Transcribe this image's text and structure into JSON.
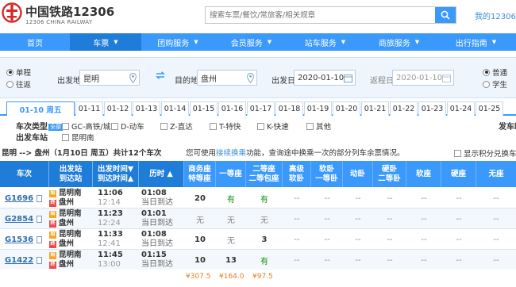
{
  "header": {
    "brand_cn": "中国铁路12306",
    "brand_en": "12306 CHINA RAILWAY",
    "search_placeholder": "搜索车票/餐饮/常旅客/相关规章",
    "my_account": "我的12306"
  },
  "nav": {
    "items": [
      {
        "label": "首页",
        "caret": false
      },
      {
        "label": "车票",
        "caret": true
      },
      {
        "label": "团购服务",
        "caret": true
      },
      {
        "label": "会员服务",
        "caret": true
      },
      {
        "label": "站车服务",
        "caret": true
      },
      {
        "label": "商旅服务",
        "caret": true
      },
      {
        "label": "出行指南",
        "caret": true
      }
    ]
  },
  "query": {
    "trip_one_way": "单程",
    "trip_round": "往返",
    "from_label": "出发地",
    "from_value": "昆明",
    "to_label": "目的地",
    "to_value": "盘州",
    "depart_label": "出发日",
    "depart_value": "2020-01-10",
    "return_label": "返程日",
    "return_value": "2020-01-10",
    "type_normal": "普通",
    "type_student": "学生"
  },
  "dates": {
    "active": "01-10 周五",
    "items": [
      "01-11",
      "01-12",
      "01-13",
      "01-14",
      "01-15",
      "01-16",
      "01-17",
      "01-18",
      "01-19",
      "01-20",
      "01-21",
      "01-22",
      "01-23",
      "01-24",
      "01-25"
    ]
  },
  "filters": {
    "type_label": "车次类型",
    "all_tag": "全部",
    "types": [
      "GC-高铁/城际",
      "D-动车",
      "Z-直达",
      "T-特快",
      "K-快速",
      "其他"
    ],
    "station_label": "出发车站",
    "stations": [
      "昆明南"
    ],
    "right_label": "发车时"
  },
  "summary": {
    "route": "昆明 --> 盘州（1月10日  周五）共计12个车次",
    "tip_prefix": "您可使用",
    "tip_link": "接续换乘",
    "tip_suffix": "功能，查询途中换乘一次的部分列车余票情况。",
    "points_label": "显示积分兑换车"
  },
  "table": {
    "headers": [
      {
        "lines": [
          "车次"
        ]
      },
      {
        "lines": [
          "出发站",
          "到达站"
        ]
      },
      {
        "lines": [
          "出发时间▼",
          "到达时间▲"
        ]
      },
      {
        "lines": [
          "历时 ▲"
        ]
      },
      {
        "lines": [
          "商务座",
          "特等座"
        ]
      },
      {
        "lines": [
          "一等座"
        ]
      },
      {
        "lines": [
          "二等座",
          "二等包座"
        ]
      },
      {
        "lines": [
          "高级",
          "软卧"
        ]
      },
      {
        "lines": [
          "软卧",
          "一等卧"
        ]
      },
      {
        "lines": [
          "动卧"
        ]
      },
      {
        "lines": [
          "硬卧",
          "二等卧"
        ]
      },
      {
        "lines": [
          "软座"
        ]
      },
      {
        "lines": [
          "硬座"
        ]
      },
      {
        "lines": [
          "无座"
        ]
      }
    ],
    "start_badge": "始",
    "end_badge": "终",
    "rows": [
      {
        "train": "G1696",
        "from": "昆明南",
        "to": "盘州",
        "dep": "11:06",
        "arr": "12:14",
        "dur1": "01:08",
        "dur2": "当日到达",
        "biz": "20",
        "first": "有",
        "second": "有",
        "rest": [
          "--",
          "--",
          "--",
          "--",
          "--",
          "--",
          "--"
        ]
      },
      {
        "train": "G2854",
        "from": "昆明南",
        "to": "盘州",
        "dep": "11:23",
        "arr": "12:24",
        "dur1": "01:01",
        "dur2": "当日到达",
        "biz": "无",
        "first": "无",
        "second": "无",
        "rest": [
          "--",
          "--",
          "--",
          "--",
          "--",
          "--",
          "--"
        ]
      },
      {
        "train": "G1536",
        "from": "昆明南",
        "to": "盘州",
        "dep": "11:33",
        "arr": "12:41",
        "dur1": "01:08",
        "dur2": "当日到达",
        "biz": "10",
        "first": "无",
        "second": "3",
        "rest": [
          "--",
          "--",
          "--",
          "--",
          "--",
          "--",
          "--"
        ]
      },
      {
        "train": "G1422",
        "from": "昆明南",
        "to": "盘州",
        "dep": "11:45",
        "arr": "13:00",
        "dur1": "01:15",
        "dur2": "当日到达",
        "biz": "10",
        "first": "13",
        "second": "有",
        "rest": [
          "--",
          "--",
          "--",
          "--",
          "--",
          "--",
          "--"
        ]
      }
    ],
    "prices": [
      "¥307.5",
      "¥164.0",
      "¥97.5"
    ]
  },
  "colors": {
    "primary": "#3b99fc",
    "primary_dark": "#1f7cd8",
    "price": "#e67e22",
    "available": "#1a8f1a"
  }
}
